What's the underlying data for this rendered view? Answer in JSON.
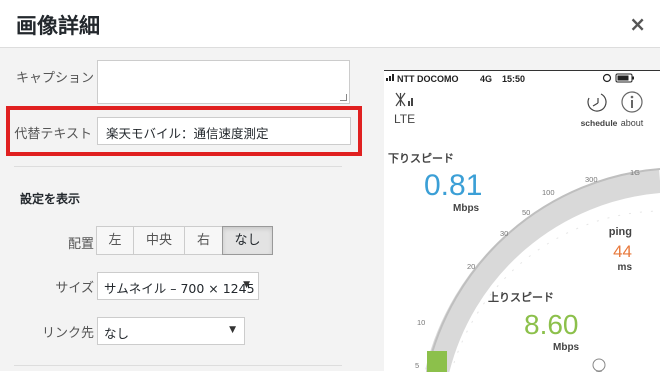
{
  "header": {
    "title": "画像詳細",
    "close": "×"
  },
  "form": {
    "caption_label": "キャプション",
    "caption_value": "",
    "alt_label": "代替テキスト",
    "alt_value": "楽天モバイル：通信速度測定",
    "section_title": "設定を表示",
    "align_label": "配置",
    "align_options": [
      "左",
      "中央",
      "右",
      "なし"
    ],
    "align_selected": "なし",
    "size_label": "サイズ",
    "size_value": "サムネイル – 700 × 1245",
    "link_label": "リンク先",
    "link_value": "なし"
  },
  "phone": {
    "carrier": "NTT DOCOMO",
    "network": "4G",
    "time": "15:50",
    "lte": "LTE",
    "schedule": "schedule",
    "about": "about",
    "download_label": "下りスピード",
    "download_value": "0.81",
    "download_unit": "Mbps",
    "ping_label": "ping",
    "ping_value": "44",
    "ping_unit": "ms",
    "upload_label": "上りスピード",
    "upload_value": "8.60",
    "upload_unit": "Mbps",
    "gauge_ticks": [
      "5",
      "10",
      "20",
      "30",
      "50",
      "100",
      "300",
      "1G"
    ],
    "colors": {
      "download": "#3b9fd6",
      "ping": "#e8793c",
      "upload": "#8cc04b"
    }
  }
}
